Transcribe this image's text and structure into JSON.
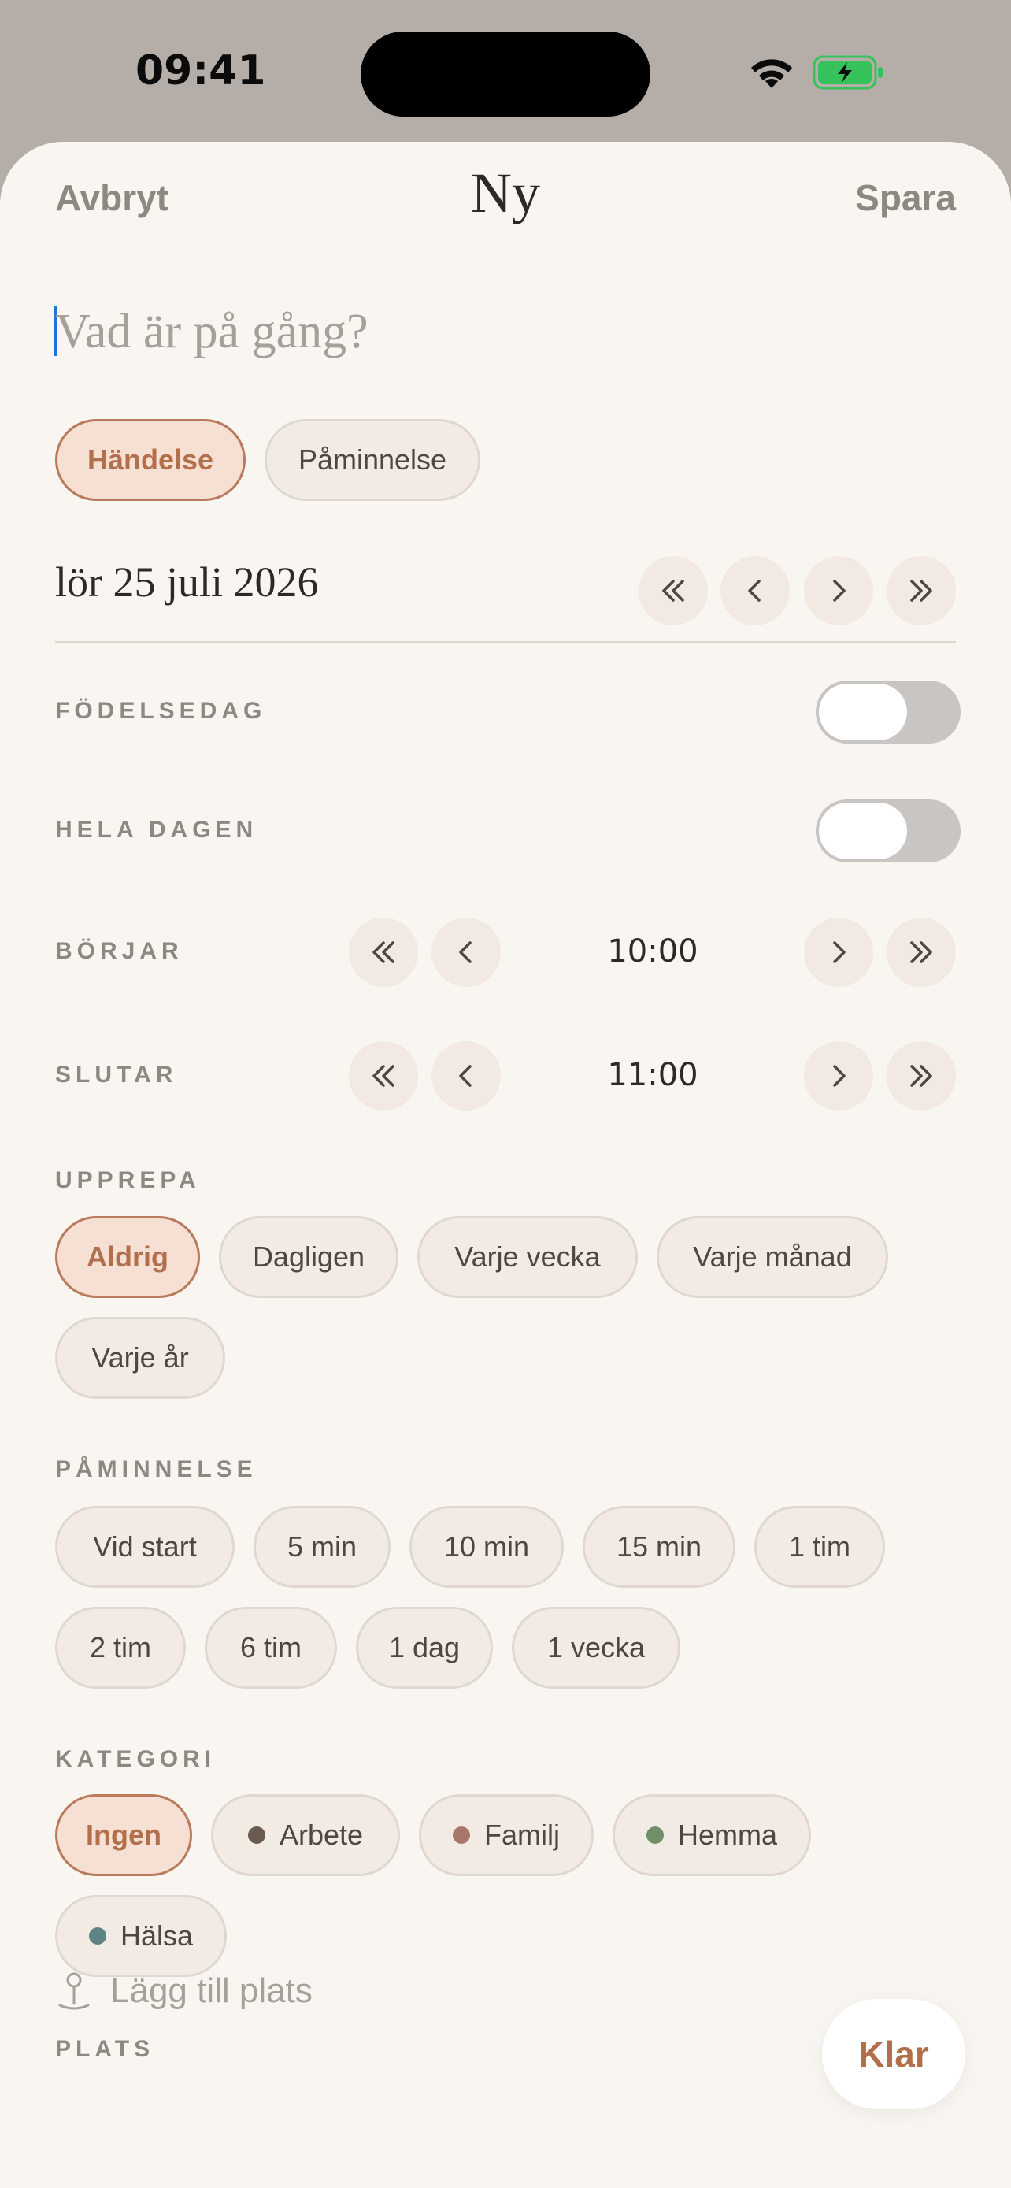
{
  "status_bar": {
    "time": "09:41"
  },
  "nav": {
    "cancel": "Avbryt",
    "title": "Ny",
    "save": "Spara"
  },
  "title_input": {
    "placeholder": "Vad är på gång?",
    "value": ""
  },
  "type_options": [
    {
      "label": "Händelse",
      "selected": true
    },
    {
      "label": "Påminnelse",
      "selected": false
    }
  ],
  "date": {
    "text": "lör 25 juli 2026"
  },
  "birthday": {
    "label": "FÖDELSEDAG",
    "on": false
  },
  "all_day": {
    "label": "HELA DAGEN",
    "on": false
  },
  "starts": {
    "label": "BÖRJAR",
    "time": "10:00"
  },
  "ends": {
    "label": "SLUTAR",
    "time": "11:00"
  },
  "repeat": {
    "label": "UPPREPA",
    "options": [
      "Aldrig",
      "Dagligen",
      "Varje vecka",
      "Varje månad",
      "Varje år"
    ],
    "selected": "Aldrig"
  },
  "reminder": {
    "label": "PÅMINNELSE",
    "options": [
      "Vid start",
      "5 min",
      "10 min",
      "15 min",
      "1 tim",
      "2 tim",
      "6 tim",
      "1 dag",
      "1 vecka"
    ],
    "selected": null
  },
  "category": {
    "label": "KATEGORI",
    "options": [
      {
        "label": "Ingen",
        "color": null
      },
      {
        "label": "Arbete",
        "color": "#6b5a50"
      },
      {
        "label": "Familj",
        "color": "#a8766a"
      },
      {
        "label": "Hemma",
        "color": "#6f8f6a"
      },
      {
        "label": "Hälsa",
        "color": "#5e8584"
      }
    ],
    "selected": "Ingen"
  },
  "place": {
    "label": "PLATS",
    "placeholder": "Lägg till plats"
  },
  "done_button": "Klar",
  "colors": {
    "accent": "#b16f4c",
    "accent_bg": "#f6dfd3",
    "sheet_bg": "#f9f6f2"
  }
}
